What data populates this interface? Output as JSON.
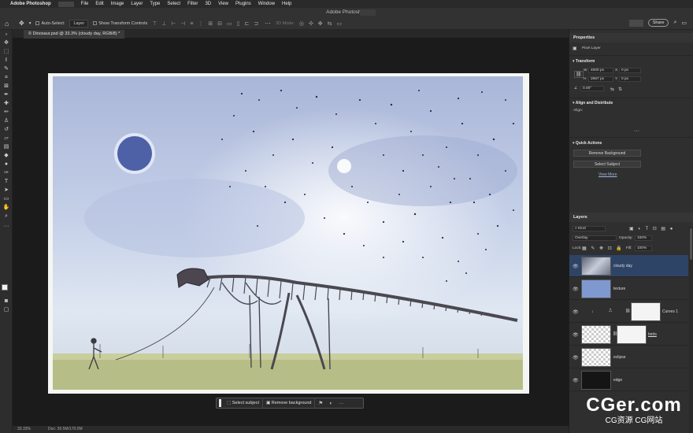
{
  "menubar": {
    "app_name": "Adobe Photoshop",
    "items": [
      "File",
      "Edit",
      "Image",
      "Layer",
      "Type",
      "Select",
      "Filter",
      "3D",
      "View",
      "Plugins",
      "Window",
      "Help"
    ]
  },
  "titlebar": {
    "title": "Adobe Photoshop"
  },
  "options": {
    "auto_select_label": "Auto-Select:",
    "auto_select_value": "Layer",
    "transform_controls_label": "Show Transform Controls",
    "mode_label": "3D Mode:",
    "share_label": "Share"
  },
  "document": {
    "tab_title": "© Dinosaur.psd @ 33.3% (cloudy day, RGB/8) *"
  },
  "taskbar": {
    "select_subject": "Select subject",
    "remove_background": "Remove background"
  },
  "status": {
    "zoom": "33.33%",
    "doc": "Doc: 30.5M/170.0M"
  },
  "properties": {
    "title": "Properties",
    "layer_type": "Pixel Layer",
    "transform": {
      "title": "Transform",
      "w_label": "W",
      "w": "4000 px",
      "h_label": "H",
      "h": "2667 px",
      "x_label": "X",
      "x": "0 px",
      "y_label": "Y",
      "y": "0 px",
      "angle": "0.00°"
    },
    "align": {
      "title": "Align and Distribute",
      "align_label": "Align:"
    },
    "quick_actions": {
      "title": "Quick Actions",
      "remove_background": "Remove Background",
      "select_subject": "Select Subject",
      "view_more": "View More"
    }
  },
  "layers": {
    "title": "Layers",
    "filter_kind": "Kind",
    "blend_mode": "Overlay",
    "opacity_label": "Opacity:",
    "opacity": "100%",
    "lock_label": "Lock:",
    "fill_label": "Fill:",
    "fill": "100%",
    "items": [
      {
        "name": "cloudy day",
        "selected": true
      },
      {
        "name": "texture",
        "selected": false
      },
      {
        "name": "Curves 1",
        "selected": false
      },
      {
        "name": "birds",
        "selected": false
      },
      {
        "name": "eclipse",
        "selected": false
      },
      {
        "name": "edge",
        "selected": false
      }
    ]
  },
  "watermark": {
    "big": "CGer.com",
    "small": "CG资源 CG网站"
  },
  "colors": {
    "accent": "#2e4466",
    "panel": "#2f2f2f",
    "canvas": "#1b1b1b"
  }
}
